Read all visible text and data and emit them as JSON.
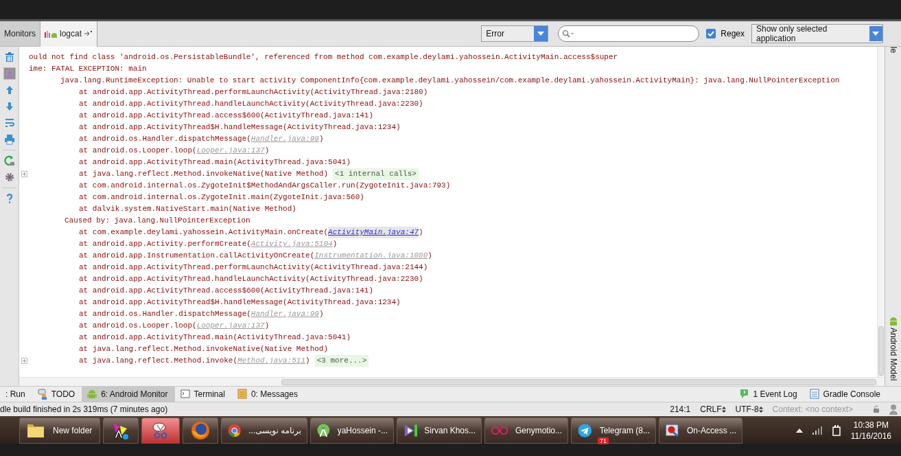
{
  "toolbar": {
    "tabs": [
      {
        "label": "Monitors",
        "selected": false,
        "kind": "plain"
      },
      {
        "label": "logcat",
        "selected": true,
        "kind": "logcat"
      }
    ],
    "level_filter": "Error",
    "regex": {
      "label": "Regex",
      "checked": true
    },
    "app_filter": "Show only selected application"
  },
  "log_lines": [
    {
      "kind": "header",
      "parts": [
        {
          "kind": "plain",
          "text": "ould not find class 'android.os.PersistableBundle', referenced from method com.example.deylami.yahossein.ActivityMain.access$super"
        }
      ]
    },
    {
      "kind": "header",
      "parts": [
        {
          "kind": "plain",
          "text": "ime: FATAL EXCEPTION: main"
        }
      ]
    },
    {
      "kind": "exception",
      "parts": [
        {
          "kind": "plain",
          "text": "java.lang.RuntimeException: Unable to start activity ComponentInfo{com.example.deylami.yahossein/com.example.deylami.yahossein.ActivityMain}: java.lang.NullPointerException"
        }
      ]
    },
    {
      "kind": "frame",
      "parts": [
        {
          "kind": "plain",
          "text": "at android.app.ActivityThread.performLaunchActivity(ActivityThread.java:2180)"
        }
      ]
    },
    {
      "kind": "frame",
      "parts": [
        {
          "kind": "plain",
          "text": "at android.app.ActivityThread.handleLaunchActivity(ActivityThread.java:2230)"
        }
      ]
    },
    {
      "kind": "frame",
      "parts": [
        {
          "kind": "plain",
          "text": "at android.app.ActivityThread.access$600(ActivityThread.java:141)"
        }
      ]
    },
    {
      "kind": "frame",
      "parts": [
        {
          "kind": "plain",
          "text": "at android.app.ActivityThread$H.handleMessage(ActivityThread.java:1234)"
        }
      ]
    },
    {
      "kind": "frame",
      "parts": [
        {
          "kind": "plain",
          "text": "at android.os.Handler.dispatchMessage("
        },
        {
          "kind": "source",
          "text": "Handler.java:99"
        },
        {
          "kind": "plain",
          "text": ")"
        }
      ]
    },
    {
      "kind": "frame",
      "parts": [
        {
          "kind": "plain",
          "text": "at android.os.Looper.loop("
        },
        {
          "kind": "source",
          "text": "Looper.java:137"
        },
        {
          "kind": "plain",
          "text": ")"
        }
      ]
    },
    {
      "kind": "frame",
      "parts": [
        {
          "kind": "plain",
          "text": "at android.app.ActivityThread.main(ActivityThread.java:5041)"
        }
      ]
    },
    {
      "kind": "frame",
      "parts": [
        {
          "kind": "plain",
          "text": "at java.lang.reflect.Method.invokeNative(Native Method)"
        },
        {
          "kind": "fold",
          "text": "<1 internal calls>"
        }
      ]
    },
    {
      "kind": "frame",
      "parts": [
        {
          "kind": "plain",
          "text": "at com.android.internal.os.ZygoteInit$MethodAndArgsCaller.run(ZygoteInit.java:793)"
        }
      ]
    },
    {
      "kind": "frame",
      "parts": [
        {
          "kind": "plain",
          "text": "at com.android.internal.os.ZygoteInit.main(ZygoteInit.java:560)"
        }
      ]
    },
    {
      "kind": "frame",
      "parts": [
        {
          "kind": "plain",
          "text": "at dalvik.system.NativeStart.main(Native Method)"
        }
      ]
    },
    {
      "kind": "cause",
      "parts": [
        {
          "kind": "plain",
          "text": "Caused by: java.lang.NullPointerException"
        }
      ]
    },
    {
      "kind": "frame",
      "parts": [
        {
          "kind": "plain",
          "text": "at com.example.deylami.yahossein.ActivityMain.onCreate("
        },
        {
          "kind": "link",
          "text": "ActivityMain.java:47"
        },
        {
          "kind": "plain",
          "text": ")"
        }
      ]
    },
    {
      "kind": "frame",
      "parts": [
        {
          "kind": "plain",
          "text": "at android.app.Activity.performCreate("
        },
        {
          "kind": "source",
          "text": "Activity.java:5104"
        },
        {
          "kind": "plain",
          "text": ")"
        }
      ]
    },
    {
      "kind": "frame",
      "parts": [
        {
          "kind": "plain",
          "text": "at android.app.Instrumentation.callActivityOnCreate("
        },
        {
          "kind": "source",
          "text": "Instrumentation.java:1080"
        },
        {
          "kind": "plain",
          "text": ")"
        }
      ]
    },
    {
      "kind": "frame",
      "parts": [
        {
          "kind": "plain",
          "text": "at android.app.ActivityThread.performLaunchActivity(ActivityThread.java:2144)"
        }
      ]
    },
    {
      "kind": "frame",
      "parts": [
        {
          "kind": "plain",
          "text": "at android.app.ActivityThread.handleLaunchActivity(ActivityThread.java:2230)"
        }
      ]
    },
    {
      "kind": "frame",
      "parts": [
        {
          "kind": "plain",
          "text": "at android.app.ActivityThread.access$600(ActivityThread.java:141)"
        }
      ]
    },
    {
      "kind": "frame",
      "parts": [
        {
          "kind": "plain",
          "text": "at android.app.ActivityThread$H.handleMessage(ActivityThread.java:1234)"
        }
      ]
    },
    {
      "kind": "frame",
      "parts": [
        {
          "kind": "plain",
          "text": "at android.os.Handler.dispatchMessage("
        },
        {
          "kind": "source",
          "text": "Handler.java:99"
        },
        {
          "kind": "plain",
          "text": ")"
        }
      ]
    },
    {
      "kind": "frame",
      "parts": [
        {
          "kind": "plain",
          "text": "at android.os.Looper.loop("
        },
        {
          "kind": "source",
          "text": "Looper.java:137"
        },
        {
          "kind": "plain",
          "text": ")"
        }
      ]
    },
    {
      "kind": "frame",
      "parts": [
        {
          "kind": "plain",
          "text": "at android.app.ActivityThread.main(ActivityThread.java:5041)"
        }
      ]
    },
    {
      "kind": "frame",
      "parts": [
        {
          "kind": "plain",
          "text": "at java.lang.reflect.Method.invokeNative(Native Method)"
        }
      ]
    },
    {
      "kind": "frame",
      "parts": [
        {
          "kind": "plain",
          "text": "at java.lang.reflect.Method.invoke("
        },
        {
          "kind": "source",
          "text": "Method.java:511"
        },
        {
          "kind": "plain",
          "text": ")"
        },
        {
          "kind": "fold",
          "text": "<3 more...>"
        }
      ]
    }
  ],
  "right_strip": {
    "labels": [
      "le",
      "Android Model"
    ]
  },
  "tool_windows": {
    "left": [
      {
        "label": ": Run",
        "kind": "none",
        "selected": false
      },
      {
        "label": "TODO",
        "kind": "todo",
        "selected": false
      },
      {
        "label": "6: Android Monitor",
        "kind": "android",
        "selected": true
      },
      {
        "label": "Terminal",
        "kind": "terminal",
        "selected": false
      },
      {
        "label": "0: Messages",
        "kind": "messages",
        "selected": false
      }
    ],
    "right": [
      {
        "label": "1 Event Log",
        "kind": "event",
        "selected": false
      },
      {
        "label": "Gradle Console",
        "kind": "console",
        "selected": false
      }
    ]
  },
  "status_bar": {
    "message": "dle build finished in 2s 319ms (7 minutes ago)",
    "position": "214:1",
    "line_separator": "CRLF",
    "encoding": "UTF-8",
    "context": "Context: <no context>"
  },
  "taskbar": {
    "items": [
      {
        "kind": "folder",
        "label": "New folder"
      },
      {
        "kind": "font"
      },
      {
        "kind": "scissors"
      },
      {
        "kind": "firefox"
      },
      {
        "kind": "chrome",
        "label": "برنامه نویسی..."
      },
      {
        "kind": "studio",
        "label": "yaHossein -..."
      },
      {
        "kind": "vs",
        "label": "Sirvan Khos..."
      },
      {
        "kind": "geny",
        "label": "Genymotio..."
      },
      {
        "kind": "telegram",
        "label": "Telegram (8...",
        "badge": "71"
      },
      {
        "kind": "antivirus",
        "label": "On-Access ..."
      }
    ],
    "clock": {
      "time": "10:38 PM",
      "date": "11/16/2016"
    }
  }
}
